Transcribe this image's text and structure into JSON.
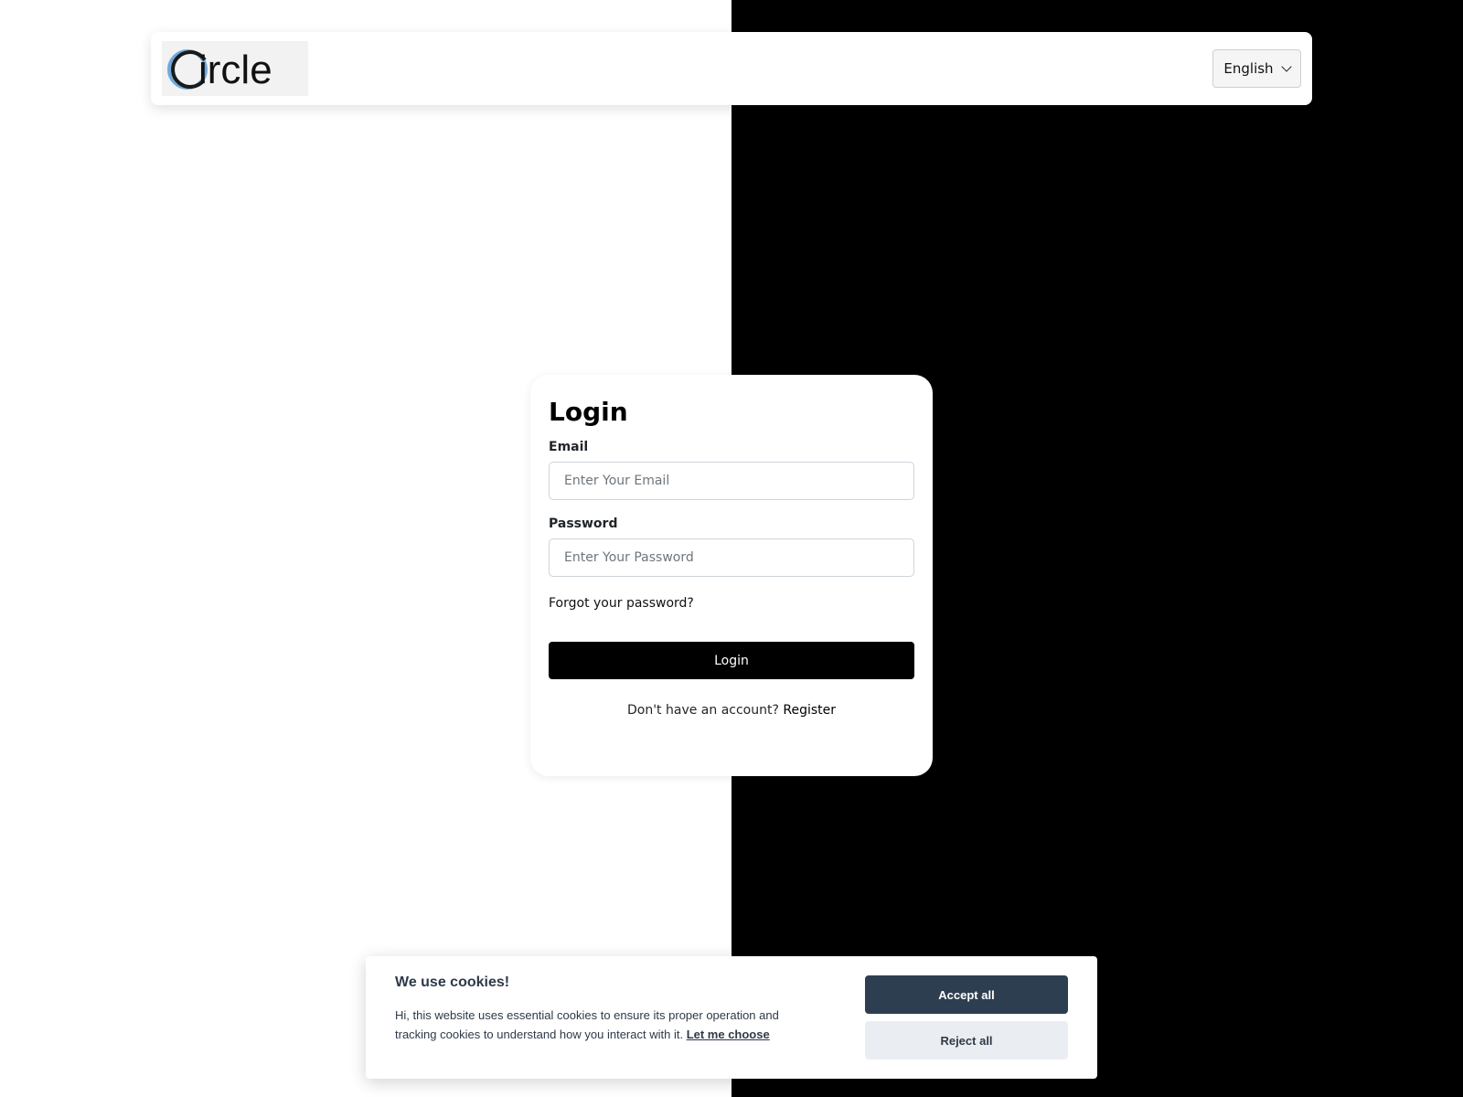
{
  "colors": {
    "left_background": "#ffffff",
    "right_background": "#000000",
    "primary_button": "#000000",
    "cookie_accept": "#2d3e50",
    "cookie_reject": "#eaeef2",
    "logo_ring": "#6fa8dc"
  },
  "header": {
    "logo_text": "Circle",
    "language_selected": "English"
  },
  "login": {
    "title": "Login",
    "email_label": "Email",
    "email_placeholder": "Enter Your Email",
    "email_value": "",
    "password_label": "Password",
    "password_placeholder": "Enter Your Password",
    "password_value": "",
    "forgot_link": "Forgot your password?",
    "submit_label": "Login",
    "no_account_text": "Don't have an account?",
    "register_link": "Register"
  },
  "cookie_banner": {
    "title": "We use cookies!",
    "message": "Hi, this website uses essential cookies to ensure its proper operation and tracking cookies to understand how you interact with it.",
    "choose_link": "Let me choose",
    "accept_label": "Accept all",
    "reject_label": "Reject all"
  }
}
